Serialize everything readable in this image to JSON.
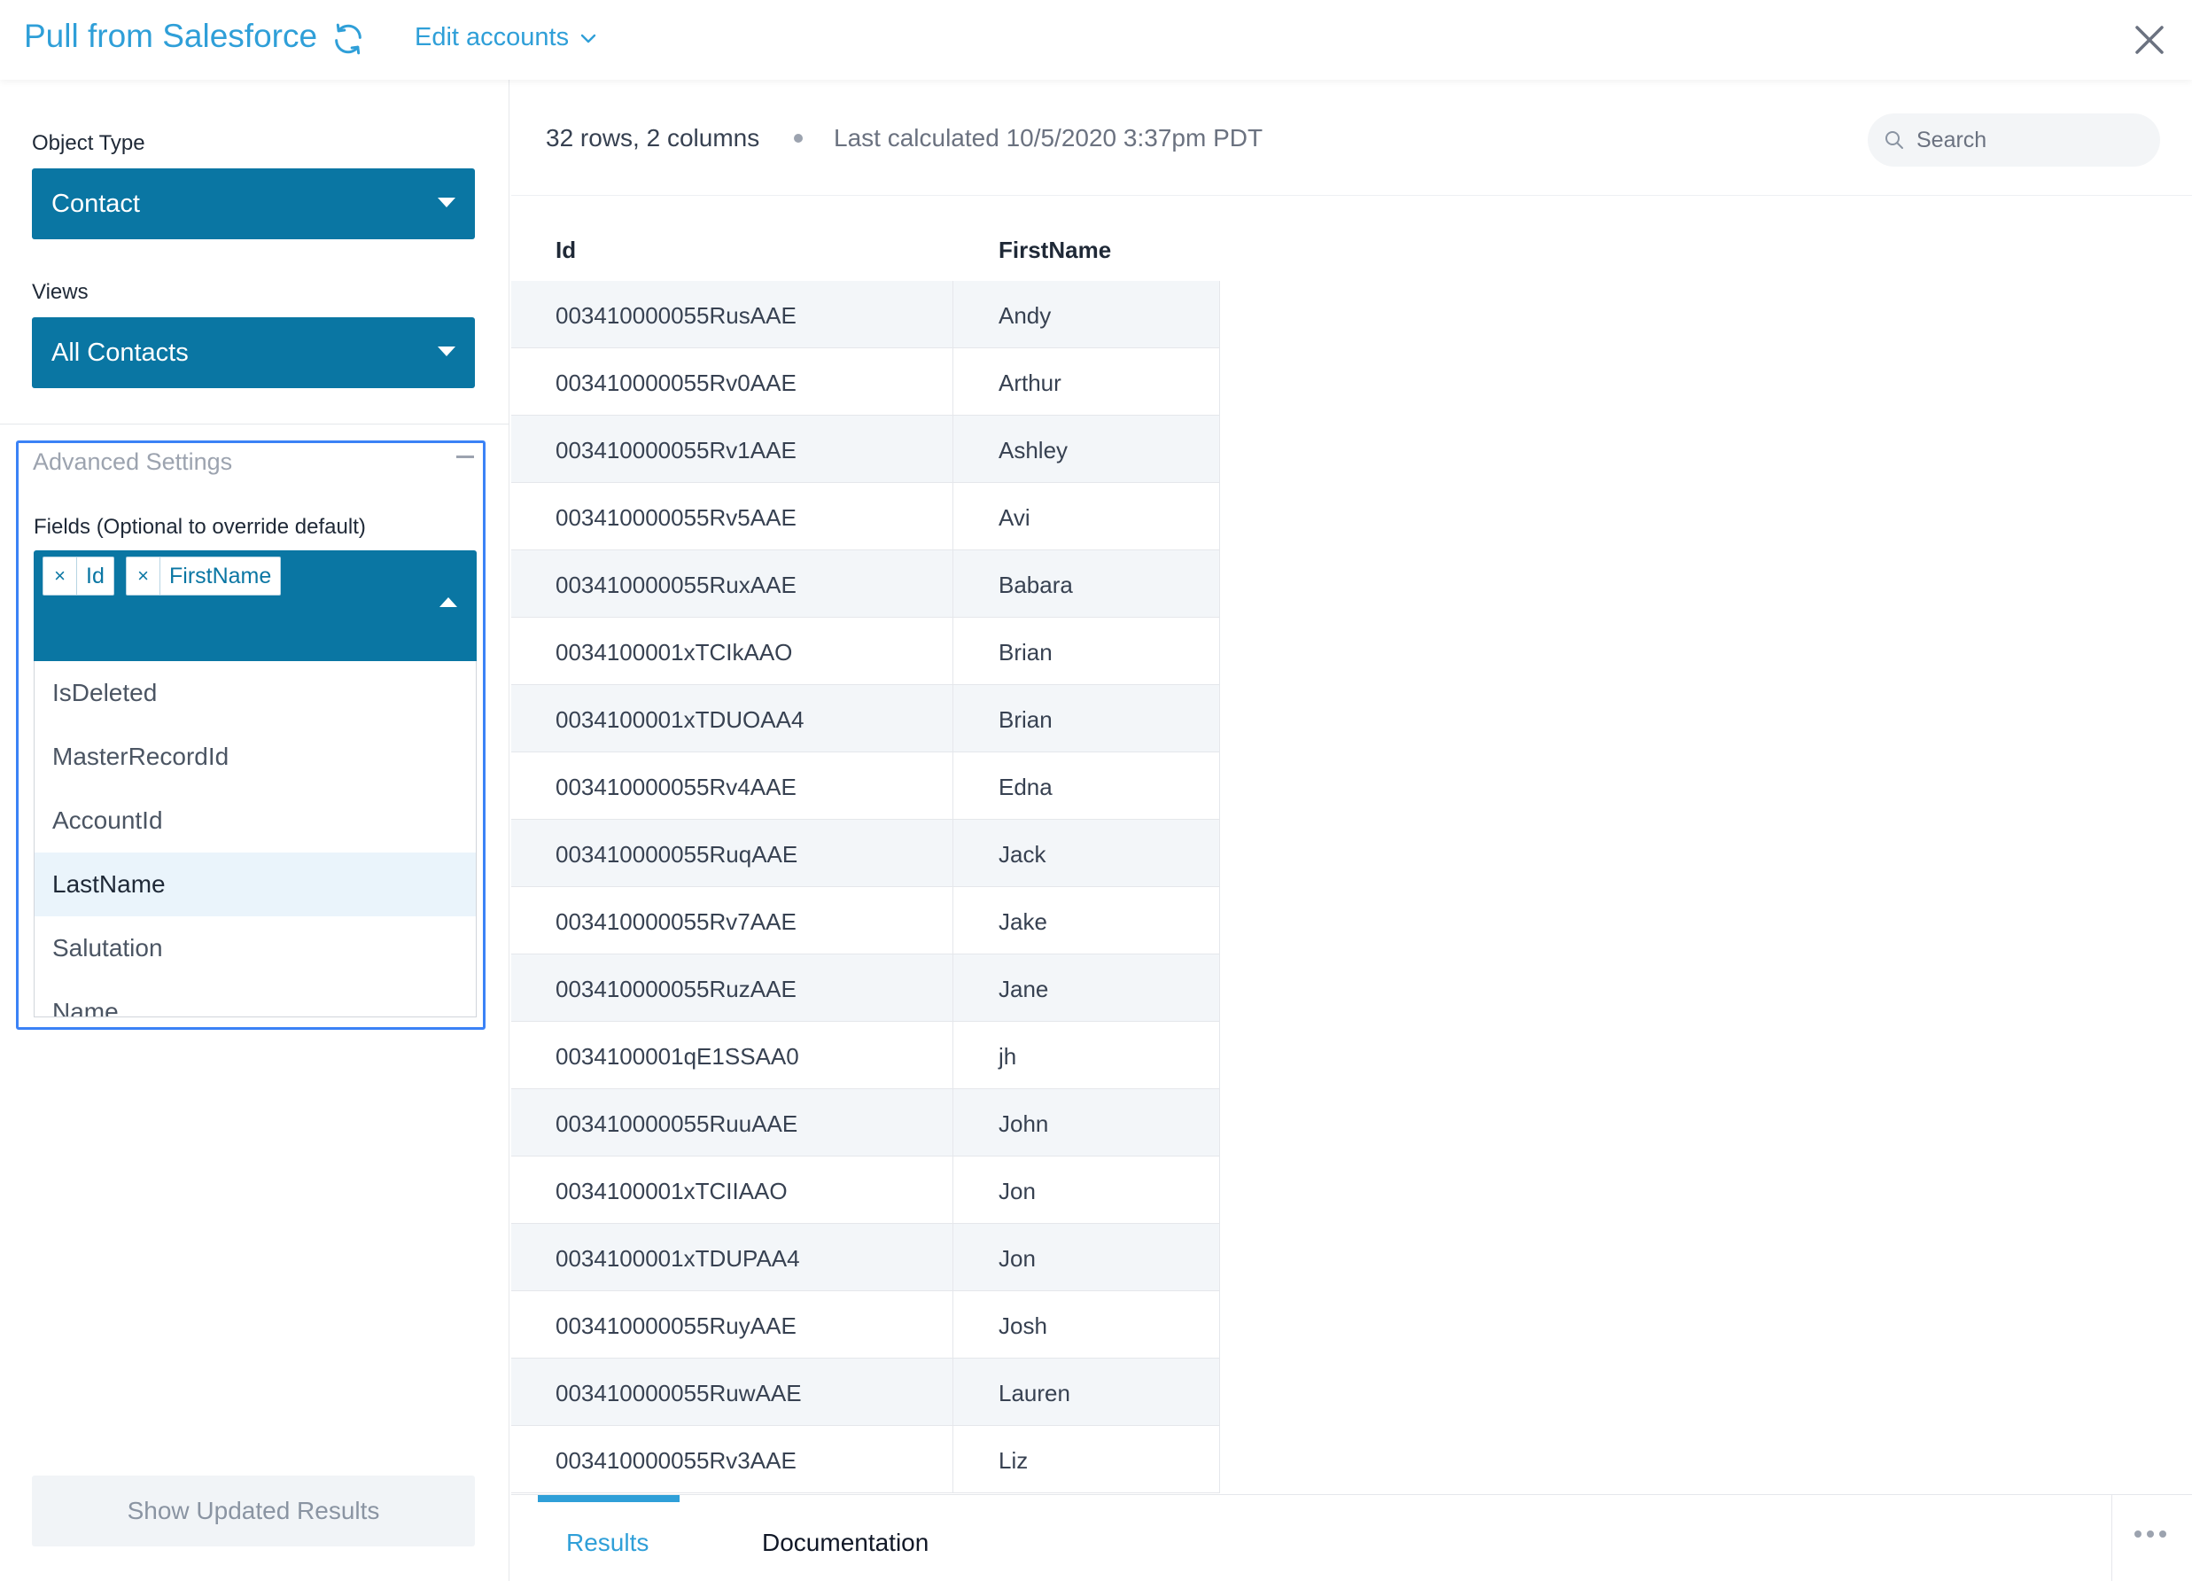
{
  "header": {
    "title": "Pull from Salesforce",
    "edit_accounts": "Edit accounts"
  },
  "sidebar": {
    "object_type_label": "Object Type",
    "object_type_value": "Contact",
    "views_label": "Views",
    "views_value": "All Contacts",
    "advanced_title": "Advanced Settings",
    "fields_label": "Fields (Optional to override default)",
    "selected_fields": [
      "Id",
      "FirstName"
    ],
    "dropdown_options": [
      "IsDeleted",
      "MasterRecordId",
      "AccountId",
      "LastName",
      "Salutation",
      "Name"
    ],
    "highlighted_option": "LastName",
    "show_button": "Show Updated Results"
  },
  "main": {
    "summary": "32 rows, 2 columns",
    "last_calculated": "Last calculated 10/5/2020 3:37pm PDT",
    "search_placeholder": "Search",
    "columns": [
      "Id",
      "FirstName"
    ],
    "rows": [
      [
        "003410000055RusAAE",
        "Andy"
      ],
      [
        "003410000055Rv0AAE",
        "Arthur"
      ],
      [
        "003410000055Rv1AAE",
        "Ashley"
      ],
      [
        "003410000055Rv5AAE",
        "Avi"
      ],
      [
        "003410000055RuxAAE",
        "Babara"
      ],
      [
        "0034100001xTCIkAAO",
        "Brian"
      ],
      [
        "0034100001xTDUOAA4",
        "Brian"
      ],
      [
        "003410000055Rv4AAE",
        "Edna"
      ],
      [
        "003410000055RuqAAE",
        "Jack"
      ],
      [
        "003410000055Rv7AAE",
        "Jake"
      ],
      [
        "003410000055RuzAAE",
        "Jane"
      ],
      [
        "0034100001qE1SSAA0",
        "jh"
      ],
      [
        "003410000055RuuAAE",
        "John"
      ],
      [
        "0034100001xTCIIAAO",
        "Jon"
      ],
      [
        "0034100001xTDUPAA4",
        "Jon"
      ],
      [
        "003410000055RuyAAE",
        "Josh"
      ],
      [
        "003410000055RuwAAE",
        "Lauren"
      ],
      [
        "003410000055Rv3AAE",
        "Liz"
      ]
    ],
    "tabs": [
      "Results",
      "Documentation"
    ]
  },
  "colors": {
    "accent": "#2f9fd8",
    "select_bg": "#0a76a3",
    "focus_border": "#3b82f6"
  }
}
